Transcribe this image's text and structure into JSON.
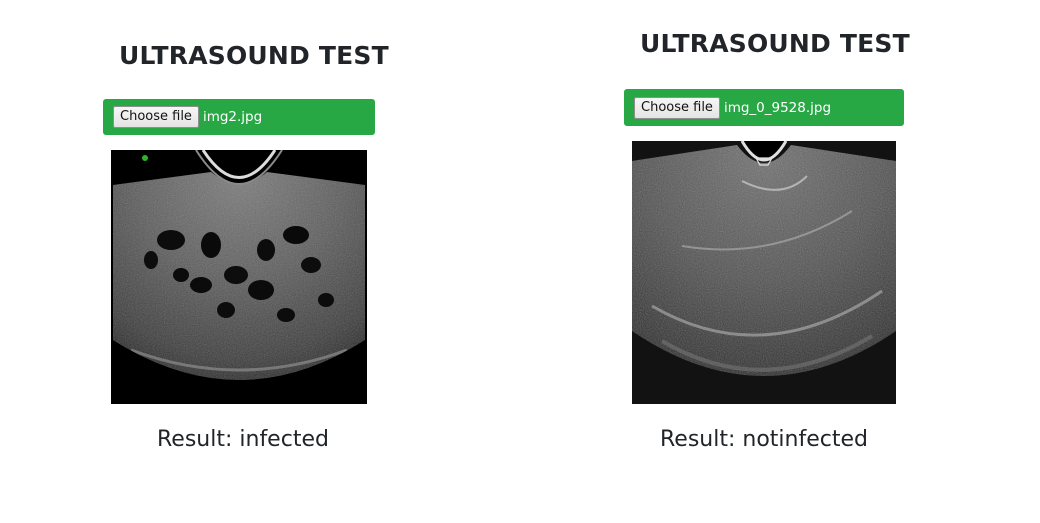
{
  "left": {
    "title": "ULTRASOUND TEST",
    "choose_label": "Choose file",
    "filename": "img2.jpg",
    "result_label": "Result: infected"
  },
  "right": {
    "title": "ULTRASOUND TEST",
    "choose_label": "Choose file",
    "filename": "img_0_9528.jpg",
    "result_label": "Result: notinfected"
  },
  "colors": {
    "upload_bar": "#28a745",
    "text": "#212529",
    "scan_background": "#000000"
  }
}
